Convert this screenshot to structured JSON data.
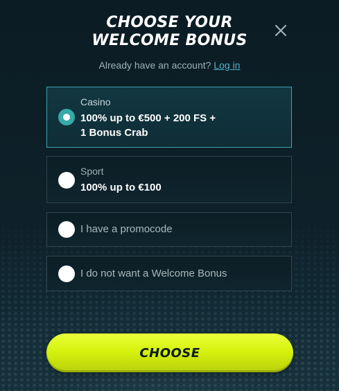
{
  "modal": {
    "title_line1": "CHOOSE YOUR",
    "title_line2": "WELCOME BONUS",
    "close_icon": "close-icon",
    "account_prompt": "Already have an account?",
    "login_link": "Log in"
  },
  "options": [
    {
      "category": "Casino",
      "description_line1": "100% up to €500 + 200 FS +",
      "description_line2": "1 Bonus Crab",
      "selected": true
    },
    {
      "category": "Sport",
      "description": "100% up to €100",
      "selected": false
    },
    {
      "label": "I have a promocode",
      "selected": false
    },
    {
      "label": "I do not want a Welcome Bonus",
      "selected": false
    }
  ],
  "choose_button": {
    "label": "CHOOSE"
  },
  "colors": {
    "accent_teal": "#35aaa7",
    "link": "#4fb6c8",
    "button_yellow": "#d6f20e",
    "background": "#0b1c24"
  }
}
